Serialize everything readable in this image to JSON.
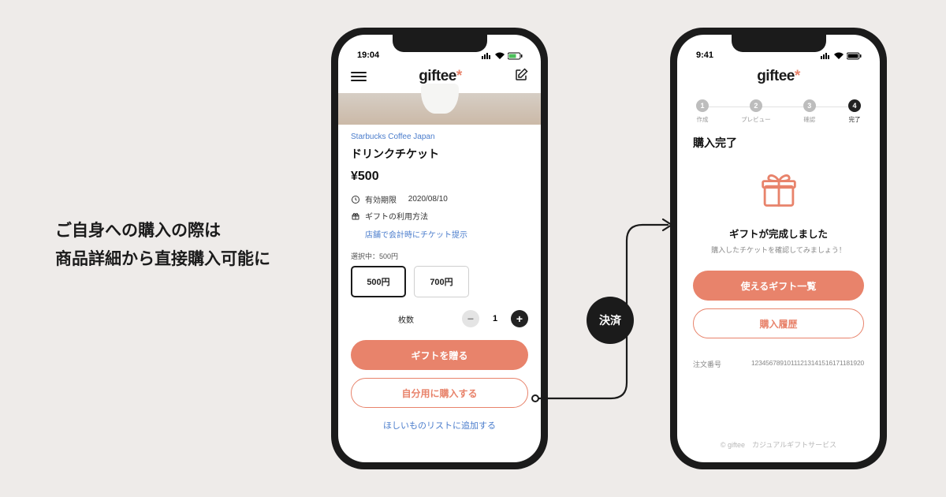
{
  "headline": {
    "line1": "ご自身への購入の際は",
    "line2": "商品詳細から直接購入可能に"
  },
  "brand": "giftee",
  "phone1": {
    "time": "19:04",
    "maker": "Starbucks Coffee Japan",
    "title": "ドリンクチケット",
    "price": "¥500",
    "expiry_label": "有効期限",
    "expiry_value": "2020/08/10",
    "usage_label": "ギフトの利用方法",
    "usage_detail": "店舗で会計時にチケット提示",
    "selecting_label": "選択中：500円",
    "opt1": "500円",
    "opt2": "700円",
    "qty_label": "枚数",
    "qty_value": "1",
    "cta_primary": "ギフトを贈る",
    "cta_outline": "自分用に購入する",
    "wishlist": "ほしいものリストに追加する"
  },
  "phone2": {
    "time": "9:41",
    "steps": [
      {
        "n": "1",
        "label": "作成"
      },
      {
        "n": "2",
        "label": "プレビュー"
      },
      {
        "n": "3",
        "label": "確認"
      },
      {
        "n": "4",
        "label": "完了"
      }
    ],
    "title": "購入完了",
    "complete_h": "ギフトが完成しました",
    "complete_sub": "購入したチケットを確認してみましょう！",
    "btn1": "使えるギフト一覧",
    "btn2": "購入履歴",
    "order_label": "注文番号",
    "order_value": "12345678910111213141516171181920",
    "footer": "© giftee　カジュアルギフトサービス"
  },
  "arrow_badge": "決済"
}
